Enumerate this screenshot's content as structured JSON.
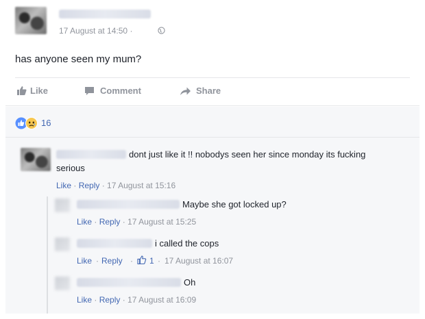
{
  "post": {
    "timestamp": "17 August at 14:50",
    "separator": "·",
    "privacy_icon": "globe-icon",
    "body": "has anyone seen my mum?"
  },
  "actions": {
    "like_label": "Like",
    "comment_label": "Comment",
    "share_label": "Share"
  },
  "reactions": {
    "icons": [
      "like-reaction-icon",
      "sad-reaction-icon"
    ],
    "count": "16"
  },
  "comments": [
    {
      "line1": "dont just like it !! nobodys seen her since monday its fucking",
      "line2": "serious",
      "like_label": "Like",
      "reply_label": "Reply",
      "timestamp": "17 August at 15:16"
    }
  ],
  "replies": [
    {
      "text": "Maybe she got locked up?",
      "like_label": "Like",
      "reply_label": "Reply",
      "timestamp": "17 August at 15:25"
    },
    {
      "text": "i called the cops",
      "like_label": "Like",
      "reply_label": "Reply",
      "like_count": "1",
      "timestamp": "17 August at 16:07"
    },
    {
      "text": "Oh",
      "like_label": "Like",
      "reply_label": "Reply",
      "timestamp": "17 August at 16:09"
    }
  ],
  "colors": {
    "link": "#4267b2",
    "muted": "#90949c",
    "text": "#1d2129",
    "comment_bg": "#f6f7f9"
  }
}
